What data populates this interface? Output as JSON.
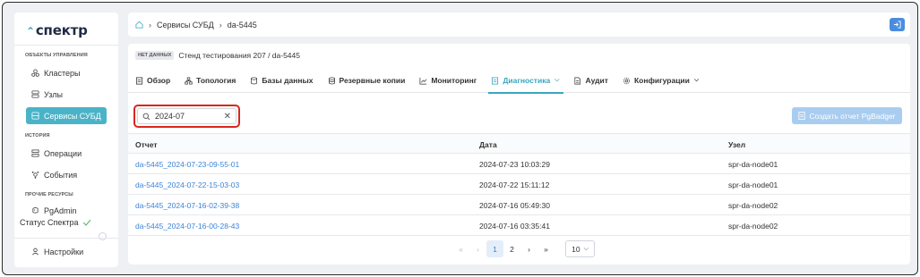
{
  "brand": {
    "name": "спектр",
    "accent": "#2aa1c9"
  },
  "sidebar": {
    "sections": {
      "management": "ОБЪЕКТЫ УПРАВЛЕНИЯ",
      "history": "ИСТОРИЯ",
      "other": "ПРОЧИЕ РЕСУРСЫ"
    },
    "items": [
      {
        "label": "Кластеры",
        "icon": "cluster-icon"
      },
      {
        "label": "Узлы",
        "icon": "server-icon"
      },
      {
        "label": "Сервисы СУБД",
        "icon": "database-icon",
        "active": true
      },
      {
        "label": "Операции",
        "icon": "operations-icon"
      },
      {
        "label": "События",
        "icon": "events-icon"
      },
      {
        "label": "PgAdmin",
        "icon": "pgadmin-icon"
      }
    ],
    "status_label": "Статус Спектра",
    "settings_label": "Настройки",
    "active_color": "#4ab3c7"
  },
  "breadcrumb": {
    "items": [
      "Сервисы СУБД",
      "da-5445"
    ]
  },
  "subtitle": {
    "badge": "НЕТ ДАННЫХ",
    "text": "Стенд тестирования 207 /  da-5445"
  },
  "tabs": [
    {
      "label": "Обзор",
      "icon": "overview-icon"
    },
    {
      "label": "Топология",
      "icon": "topology-icon"
    },
    {
      "label": "Базы данных",
      "icon": "database-icon"
    },
    {
      "label": "Резервные копии",
      "icon": "backup-icon"
    },
    {
      "label": "Мониторинг",
      "icon": "monitoring-icon"
    },
    {
      "label": "Диагностика",
      "icon": "diagnostics-icon",
      "active": true,
      "dropdown": true
    },
    {
      "label": "Аудит",
      "icon": "audit-icon"
    },
    {
      "label": "Конфигурации",
      "icon": "gear-icon",
      "dropdown": true
    }
  ],
  "search": {
    "value": "2024-07"
  },
  "report_button": {
    "label": "Создать отчет PgBadger"
  },
  "table": {
    "headers": [
      "Отчет",
      "Дата",
      "Узел"
    ],
    "rows": [
      [
        "da-5445_2024-07-23-09-55-01",
        "2024-07-23 10:03:29",
        "spr-da-node01"
      ],
      [
        "da-5445_2024-07-22-15-03-03",
        "2024-07-22 15:11:12",
        "spr-da-node01"
      ],
      [
        "da-5445_2024-07-16-02-39-38",
        "2024-07-16 05:49:30",
        "spr-da-node02"
      ],
      [
        "da-5445_2024-07-16-00-28-43",
        "2024-07-16 03:35:41",
        "spr-da-node02"
      ]
    ]
  },
  "pagination": {
    "first": "«",
    "prev": "‹",
    "pages": [
      "1",
      "2"
    ],
    "current": "1",
    "next": "›",
    "last": "»",
    "per_page": "10"
  }
}
